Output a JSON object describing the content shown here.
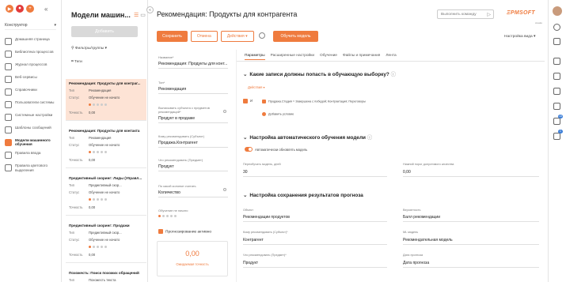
{
  "sidebar": {
    "logo_buttons": [
      "▶",
      "⏺",
      "+"
    ],
    "collapse_glyph": "«",
    "workspace": "Конструктор",
    "items": [
      {
        "label": "Домашняя страница",
        "icon": "home-icon",
        "active": false
      },
      {
        "label": "Библиотека процессов",
        "icon": "library-icon",
        "active": false
      },
      {
        "label": "Журнал процессов",
        "icon": "process-log-icon",
        "active": false
      },
      {
        "label": "Веб-сервисы",
        "icon": "web-services-icon",
        "active": false
      },
      {
        "label": "Справочники",
        "icon": "lookups-icon",
        "active": false
      },
      {
        "label": "Пользователи системы",
        "icon": "users-icon",
        "active": false
      },
      {
        "label": "Системные настройки",
        "icon": "settings-icon",
        "active": false
      },
      {
        "label": "Шаблоны сообщений",
        "icon": "templates-icon",
        "active": false
      },
      {
        "label": "Модели машинного обучения",
        "icon": "ml-models-icon",
        "active": true
      },
      {
        "label": "Правила ввода",
        "icon": "input-rules-icon",
        "active": false
      },
      {
        "label": "Правила цветового выделения",
        "icon": "color-rules-icon",
        "active": false
      }
    ]
  },
  "list": {
    "title": "Модели машин...",
    "add_label": "Добавить",
    "filters_label": "Фильтры/группы",
    "tags_label": "Теги",
    "cards": [
      {
        "title": "Рекомендация: Продукты для контраг...",
        "type_key": "Тип",
        "type": "Рекомендация",
        "status_key": "Статус",
        "status": "Обучение не начато",
        "prec_key": "Точность",
        "prec": "0,00",
        "selected": true
      },
      {
        "title": "Рекомендация: Продукты для контакта",
        "type_key": "Тип",
        "type": "Рекомендация",
        "status_key": "Статус",
        "status": "Обучение не начато",
        "prec_key": "Точность",
        "prec": "0,00",
        "selected": false
      },
      {
        "title": "Предиктивный скоринг: Лиды (Управл...",
        "type_key": "Тип",
        "type": "Предиктивный скор...",
        "status_key": "Статус",
        "status": "Обучение не начато",
        "prec_key": "Точность",
        "prec": "0,00",
        "selected": false
      },
      {
        "title": "Предиктивный скоринг: Продажи",
        "type_key": "Тип",
        "type": "Предиктивный скор...",
        "status_key": "Статус",
        "status": "Обучение не начато",
        "prec_key": "Точность",
        "prec": "0,00",
        "selected": false
      },
      {
        "title": "Похожесть: Поиск похожих обращений",
        "type_key": "Тип",
        "type": "Похожесть текста",
        "status_key": "",
        "status": "",
        "prec_key": "",
        "prec": "",
        "selected": false
      }
    ]
  },
  "header": {
    "title": "Рекомендация: Продукты для контрагента",
    "command_placeholder": "Выполнить команду",
    "brand": "ΞPMSOFT",
    "brand_sub": "creatio",
    "save": "Сохранить",
    "cancel": "Отмена",
    "actions": "Действия",
    "train": "Обучить модель",
    "view_settings": "Настройка вида"
  },
  "form": {
    "name_label": "Название*",
    "name_value": "Рекомендация: Продукты для конт...",
    "type_label": "Тип*",
    "type_value": "Рекомендация",
    "whom_label": "Выписывать субъекта с предметов рекомендаций*",
    "whom_value": "Продукт в продаже",
    "subject_label": "Кому рекомендовать (Субъект)",
    "subject_value": "Продажа.Контрагент",
    "object_label": "Что рекомендовать (Предмет)",
    "object_value": "Продукт",
    "qty_label": "По какой колонке считать",
    "qty_value": "Количество",
    "train_status_label": "Обучение не начато",
    "predict_label": "Прогнозирование активно",
    "precision_value": "0,00",
    "precision_label": "Ожидаемая точность"
  },
  "tabs": [
    "Параметры",
    "Расширенные настройки",
    "Обучение",
    "Файлы и примечания",
    "Лента"
  ],
  "details": {
    "s1_title": "Какие записи должны попасть в обучающую выборку?",
    "s1_actions": "Действия",
    "s1_and": "И",
    "s1_cond1_a": "Продажа.Стадия",
    "s1_cond1_b": "= Завершена с победой; Контрактация; Переговоры",
    "s1_add": "Добавить условие",
    "s2_title": "Настройка автоматического обучения модели",
    "s2_auto": "Автоматически обновлять модель",
    "s2_period_label": "Переобучать модель, дней",
    "s2_period": "30",
    "s2_min_label": "Нижний порог допустимого качества",
    "s2_min": "0,00",
    "s3_title": "Настройка сохранения результатов прогноза",
    "obj_label": "Объект",
    "obj_value": "Рекомендации продуктов",
    "prob_label": "Вероятность",
    "prob_value": "Балл рекомендации",
    "subj_label": "Кому рекомендовать (Субъект)*",
    "subj_value": "Контрагент",
    "ml_label": "ML модель",
    "ml_value": "Рекомендательная модель",
    "what_label": "Что рекомендовать (Предмет)*",
    "what_value": "Продукт",
    "date_label": "Дата прогноза",
    "date_value": "Дата прогноза"
  },
  "rightbar": {
    "badge1": "13",
    "badge2": "1"
  },
  "colors": {
    "accent": "#ef7b3e",
    "selected_bg": "#fde3d5"
  }
}
